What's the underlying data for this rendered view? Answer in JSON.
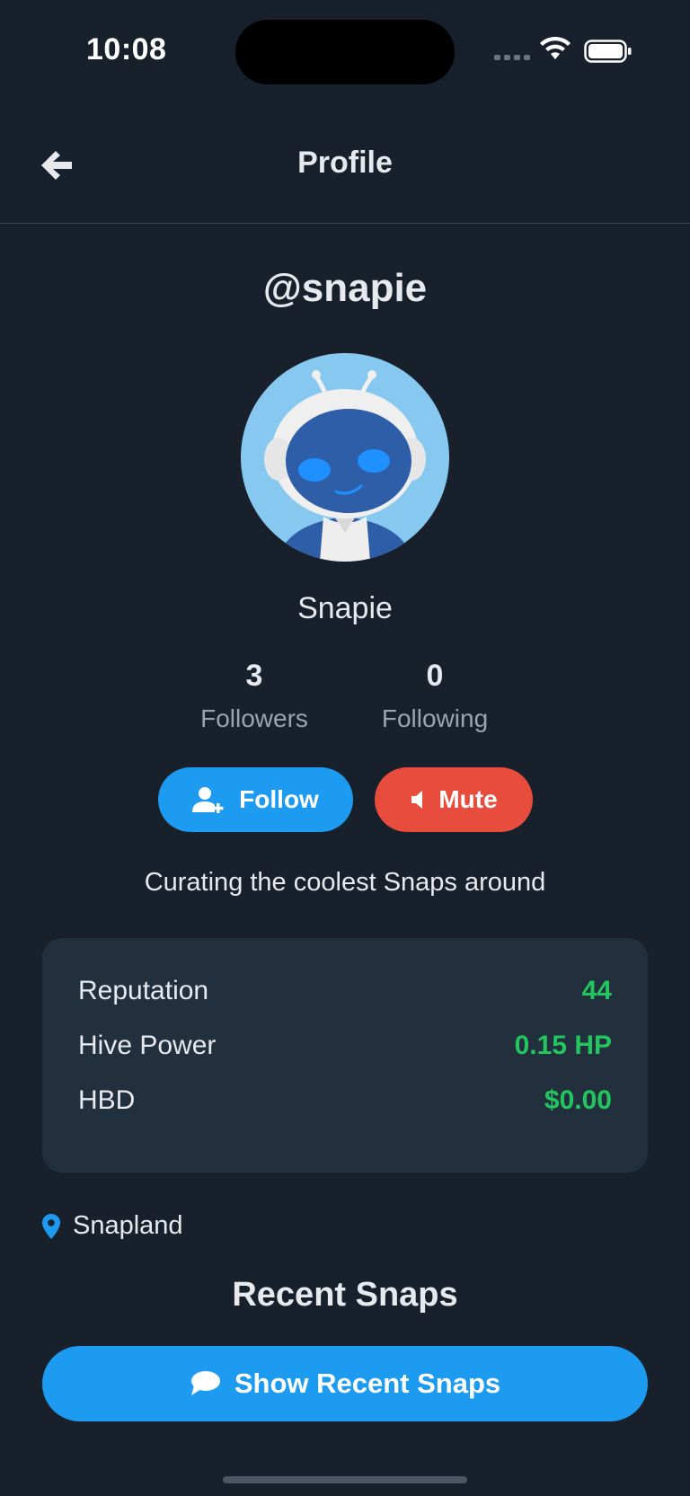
{
  "status_bar": {
    "time": "10:08"
  },
  "nav": {
    "title": "Profile",
    "back_icon": "arrow-left-icon"
  },
  "profile": {
    "username": "@snapie",
    "display_name": "Snapie",
    "followers_count": "3",
    "followers_label": "Followers",
    "following_count": "0",
    "following_label": "Following",
    "bio": "Curating the coolest Snaps around",
    "location": "Snapland"
  },
  "actions": {
    "follow_label": "Follow",
    "mute_label": "Mute",
    "follow_color": "#1d9bf0",
    "mute_color": "#e74c3c"
  },
  "wallet": {
    "rows": [
      {
        "label": "Reputation",
        "value": "44"
      },
      {
        "label": "Hive Power",
        "value": "0.15 HP"
      },
      {
        "label": "HBD",
        "value": "$0.00"
      }
    ],
    "value_color": "#22c55e"
  },
  "recent": {
    "title": "Recent Snaps",
    "button_label": "Show Recent Snaps"
  }
}
